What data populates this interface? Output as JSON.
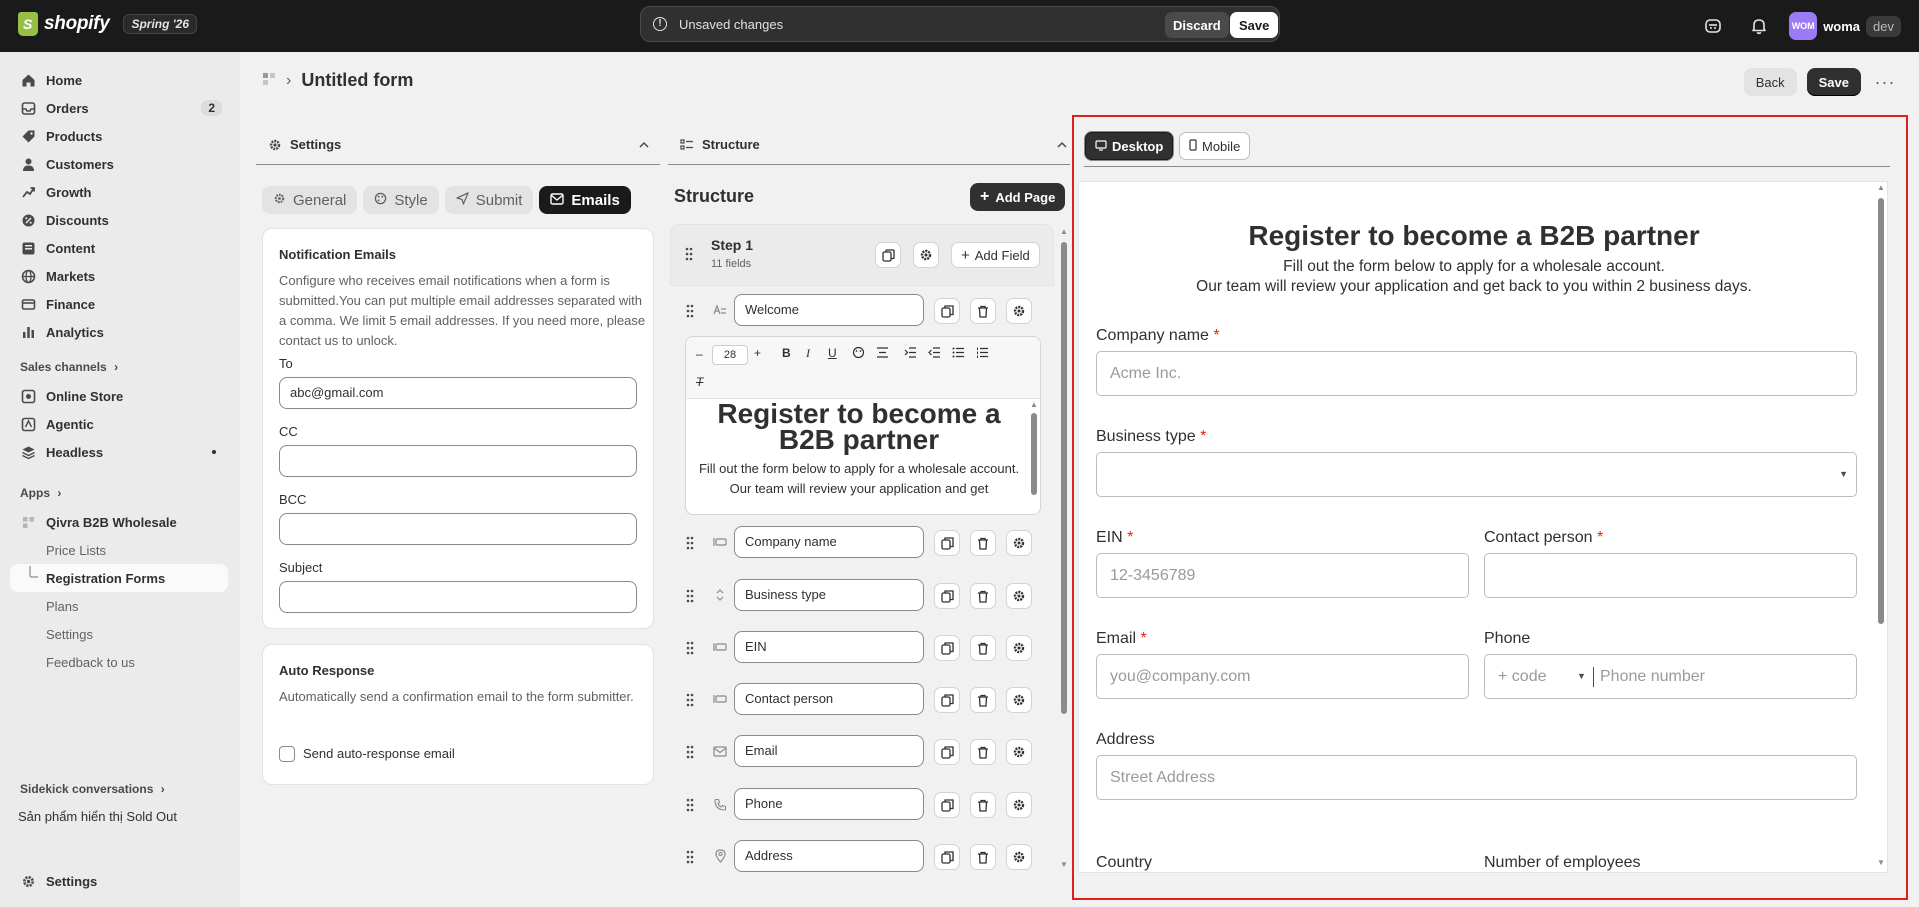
{
  "topbar": {
    "brand": "shopify",
    "edition": "Spring '26",
    "unsaved_text": "Unsaved changes",
    "discard_label": "Discard",
    "save_label": "Save",
    "avatar_initials": "WOM",
    "user_name": "woma",
    "store_badge": "dev"
  },
  "sidebar": {
    "items": [
      {
        "label": "Home",
        "icon": "home-icon"
      },
      {
        "label": "Orders",
        "icon": "orders-icon",
        "count": "2"
      },
      {
        "label": "Products",
        "icon": "products-icon"
      },
      {
        "label": "Customers",
        "icon": "customers-icon"
      },
      {
        "label": "Growth",
        "icon": "growth-icon"
      },
      {
        "label": "Discounts",
        "icon": "discounts-icon"
      },
      {
        "label": "Content",
        "icon": "content-icon"
      },
      {
        "label": "Markets",
        "icon": "markets-icon"
      },
      {
        "label": "Finance",
        "icon": "finance-icon"
      },
      {
        "label": "Analytics",
        "icon": "analytics-icon"
      }
    ],
    "sales_channels_label": "Sales channels",
    "channels": [
      {
        "label": "Online Store",
        "icon": "online-store-icon"
      },
      {
        "label": "Agentic",
        "icon": "agentic-icon"
      },
      {
        "label": "Headless",
        "icon": "headless-icon"
      }
    ],
    "apps_label": "Apps",
    "app_name": "Qivra B2B Wholesale",
    "app_subitems": [
      "Price Lists",
      "Registration Forms",
      "Plans",
      "Settings",
      "Feedback to us"
    ],
    "sidekick_label": "Sidekick conversations",
    "sidekick_item": "Sản phẩm hiển thị Sold Out",
    "settings_label": "Settings"
  },
  "header": {
    "title": "Untitled form",
    "back_label": "Back",
    "save_label": "Save"
  },
  "settings_panel": {
    "title": "Settings",
    "tabs": [
      "General",
      "Style",
      "Submit",
      "Emails"
    ],
    "active_tab": "Emails",
    "notification": {
      "title": "Notification Emails",
      "description": "Configure who receives email notifications when a form is submitted.You can put multiple email addresses separated with a comma. We limit 5 email addresses. If you need more, please contact us to unlock.",
      "to_label": "To",
      "to_value": "abc@gmail.com",
      "cc_label": "CC",
      "cc_value": "",
      "bcc_label": "BCC",
      "bcc_value": "",
      "subject_label": "Subject",
      "subject_value": ""
    },
    "auto_response": {
      "title": "Auto Response",
      "description": "Automatically send a confirmation email to the form submitter.",
      "checkbox_label": "Send auto-response email"
    }
  },
  "structure_panel": {
    "title": "Structure",
    "heading": "Structure",
    "add_page_label": "Add Page",
    "step_title": "Step 1",
    "step_count": "11 fields",
    "add_field_label": "Add Field",
    "editor": {
      "font_size": "28",
      "heading": "Register to become a B2B partner",
      "text": "Fill out the form below to apply for a wholesale account. Our team will review your application and get"
    },
    "fields": [
      {
        "name": "Welcome",
        "icon": "text-icon"
      },
      {
        "name": "Company name",
        "icon": "input-icon"
      },
      {
        "name": "Business type",
        "icon": "select-icon"
      },
      {
        "name": "EIN",
        "icon": "input-icon"
      },
      {
        "name": "Contact person",
        "icon": "input-icon"
      },
      {
        "name": "Email",
        "icon": "email-icon"
      },
      {
        "name": "Phone",
        "icon": "phone-icon"
      },
      {
        "name": "Address",
        "icon": "location-icon"
      }
    ]
  },
  "preview": {
    "desktop_label": "Desktop",
    "mobile_label": "Mobile",
    "title": "Register to become a B2B partner",
    "subtitle_1": "Fill out the form below to apply for a wholesale account.",
    "subtitle_2": "Our team will review your application and get back to you within 2 business days.",
    "company_label": "Company name",
    "company_placeholder": "Acme Inc.",
    "business_type_label": "Business type",
    "ein_label": "EIN",
    "ein_placeholder": "12-3456789",
    "contact_label": "Contact person",
    "email_label": "Email",
    "email_placeholder": "you@company.com",
    "phone_label": "Phone",
    "phone_code_placeholder": "+ code",
    "phone_number_placeholder": "Phone number",
    "address_label": "Address",
    "address_placeholder": "Street Address",
    "country_label": "Country",
    "employees_label": "Number of employees",
    "required_mark": "*"
  },
  "colors": {
    "topbar": "#1a1a1a",
    "accent_dark": "#303030",
    "required": "#d72c0d",
    "highlight_frame": "#e0201b"
  }
}
